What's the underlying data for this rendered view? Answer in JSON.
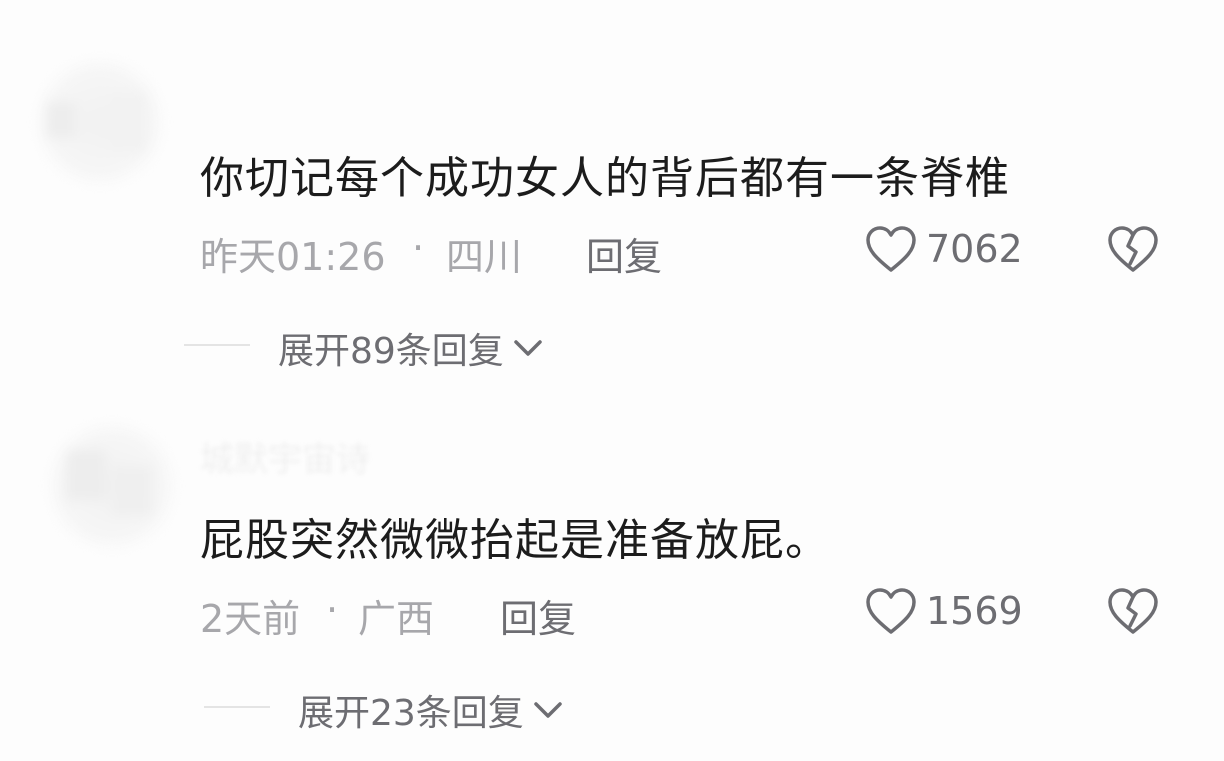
{
  "comments": [
    {
      "username": "",
      "text": "你切记每个成功女人的背后都有一条脊椎",
      "time": "昨天01:26",
      "separator": "·",
      "location": "四川",
      "reply_label": "回复",
      "like_count": "7062",
      "expand_label": "展开89条回复"
    },
    {
      "username": "城默宇宙诗",
      "text": "屁股突然微微抬起是准备放屁。",
      "time": "2天前",
      "separator": "·",
      "location": "广西",
      "reply_label": "回复",
      "like_count": "1569",
      "expand_label": "展开23条回复"
    }
  ],
  "icons": {
    "like": "heart-outline-icon",
    "dislike": "broken-heart-icon",
    "expand": "chevron-down-icon"
  },
  "colors": {
    "text_primary": "#1c1c1c",
    "text_secondary": "#a7a7ab",
    "action": "#6d6d72"
  }
}
